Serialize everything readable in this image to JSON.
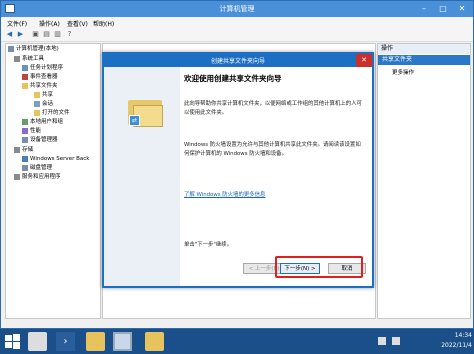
{
  "window": {
    "title": "计算机管理"
  },
  "menu": [
    "文件(F)",
    "操作(A)",
    "查看(V)",
    "帮助(H)"
  ],
  "tree": {
    "root": "计算机管理(本地)",
    "items": [
      {
        "label": "系统工具",
        "level": 1
      },
      {
        "label": "任务计划程序",
        "level": 2
      },
      {
        "label": "事件查看器",
        "level": 2
      },
      {
        "label": "共享文件夹",
        "level": 2
      },
      {
        "label": "共享",
        "level": 3
      },
      {
        "label": "会话",
        "level": 3
      },
      {
        "label": "打开的文件",
        "level": 3
      },
      {
        "label": "本地用户和组",
        "level": 2
      },
      {
        "label": "性能",
        "level": 2
      },
      {
        "label": "设备管理器",
        "level": 2
      },
      {
        "label": "存储",
        "level": 1
      },
      {
        "label": "Windows Server Back",
        "level": 2
      },
      {
        "label": "磁盘管理",
        "level": 2
      },
      {
        "label": "服务和应用程序",
        "level": 1
      }
    ]
  },
  "actions": {
    "header": "操作",
    "selected": "共享文件夹",
    "more": "更多操作"
  },
  "wizard": {
    "title": "创建共享文件夹向导",
    "heading": "欢迎使用创建共享文件夹向导",
    "para1": "此向导帮助你共享计算机文件夹，以便网络或工作组的其他计算机上的人可以使用此文件夹。",
    "para2": "Windows 防火墙设置为允许与其他计算机共享此文件夹。请阅读该设置如何保护计算机的 Windows 防火墙和设备。",
    "link": "了解 Windows 防火墙的更多信息",
    "continue": "单击\"下一步\"继续。",
    "back_btn": "< 上一步(B)",
    "next_btn": "下一步(N) >",
    "cancel_btn": "取消"
  },
  "taskbar": {
    "time": "14:34",
    "date": "2022/11/4"
  },
  "colors": {
    "accent": "#1d6fc4",
    "highlight": "#e0201c",
    "taskbar": "#1b4f8a"
  }
}
